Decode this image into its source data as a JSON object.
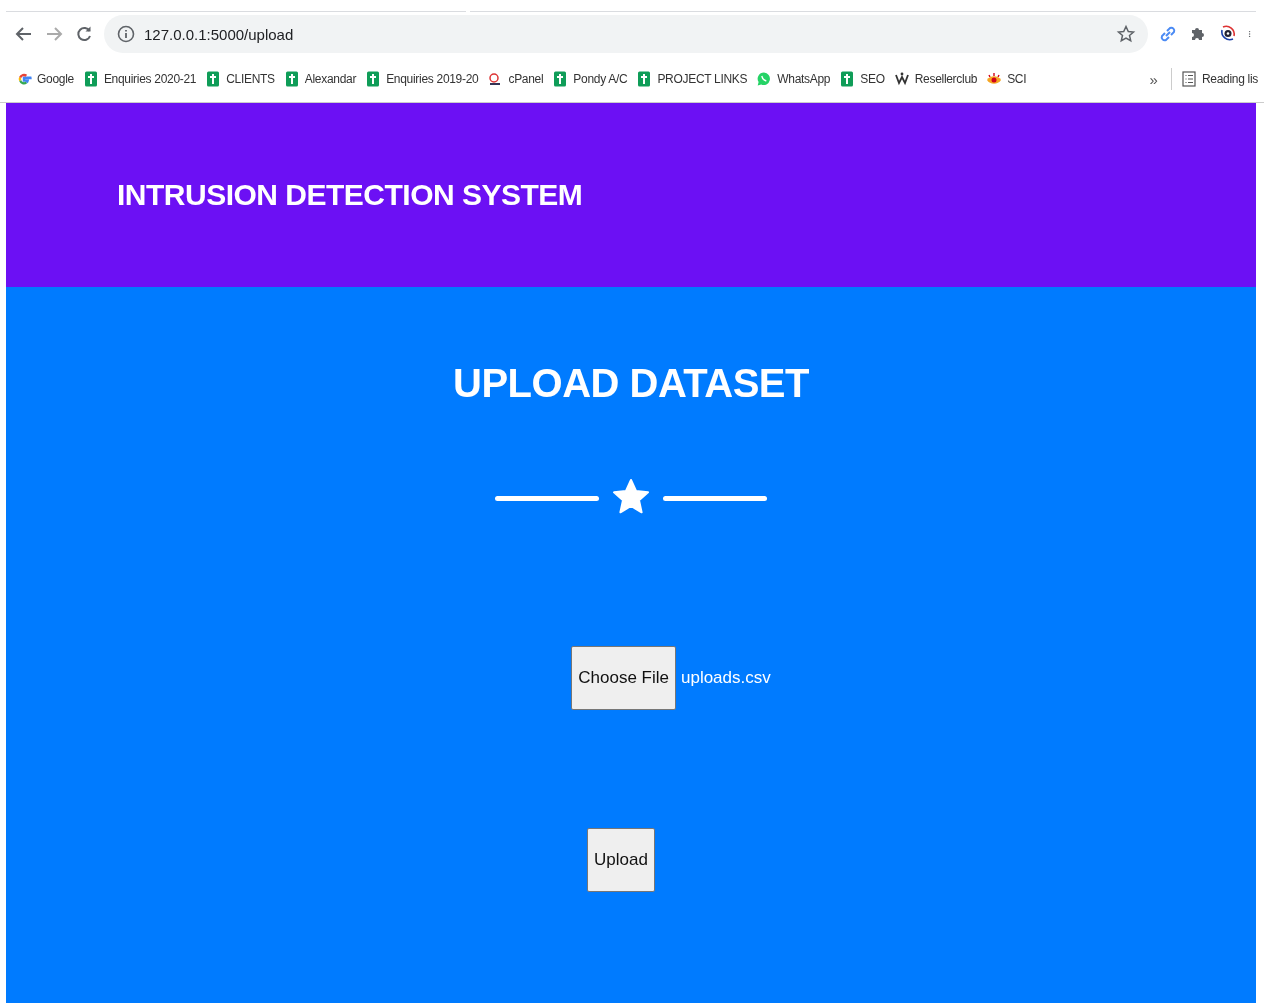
{
  "browser": {
    "address": "127.0.0.1:5000/upload",
    "bookmarks": [
      {
        "label": "Google",
        "kind": "google"
      },
      {
        "label": "Enquiries 2020-21",
        "kind": "sheet"
      },
      {
        "label": "CLIENTS",
        "kind": "sheet"
      },
      {
        "label": "Alexandar",
        "kind": "sheet"
      },
      {
        "label": "Enquiries 2019-20",
        "kind": "sheet"
      },
      {
        "label": "cPanel",
        "kind": "cpanel"
      },
      {
        "label": "Pondy A/C",
        "kind": "sheet"
      },
      {
        "label": "PROJECT LINKS",
        "kind": "sheet"
      },
      {
        "label": "WhatsApp",
        "kind": "whatsapp"
      },
      {
        "label": "SEO",
        "kind": "sheet"
      },
      {
        "label": "Resellerclub",
        "kind": "reseller"
      },
      {
        "label": "SCI",
        "kind": "sci"
      }
    ],
    "more": "»",
    "reading_list": "Reading lis"
  },
  "header": {
    "title": "INTRUSION DETECTION SYSTEM"
  },
  "upload": {
    "heading": "UPLOAD DATASET",
    "file_button": "Choose File",
    "file_name": "uploads.csv",
    "submit": "Upload"
  }
}
